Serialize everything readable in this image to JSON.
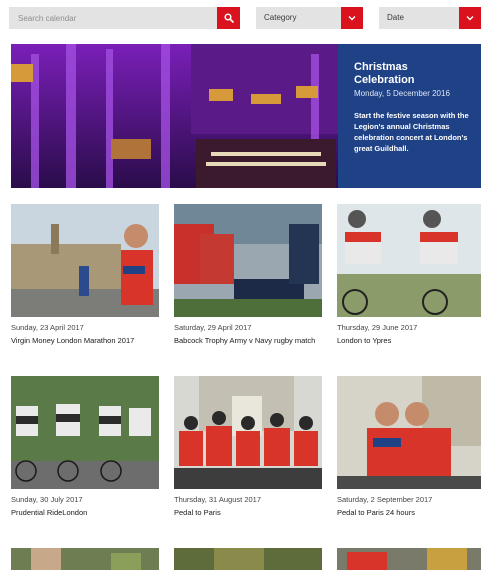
{
  "search": {
    "placeholder": "Search calendar"
  },
  "filters": {
    "category_label": "Category",
    "date_label": "Date"
  },
  "featured": {
    "title": "Christmas Celebration",
    "date": "Monday, 5 December 2016",
    "description": "Start the festive season with the Legion's annual Christmas celebration concert at London's great Guildhall."
  },
  "events": [
    {
      "date": "Sunday, 23 April 2017",
      "name": "Virgin Money London Marathon 2017"
    },
    {
      "date": "Saturday, 29 April 2017",
      "name": "Babcock Trophy Army v Navy rugby match"
    },
    {
      "date": "Thursday, 29 June 2017",
      "name": "London to Ypres"
    },
    {
      "date": "Sunday, 30 July 2017",
      "name": "Prudential RideLondon"
    },
    {
      "date": "Thursday, 31 August 2017",
      "name": "Pedal to Paris"
    },
    {
      "date": "Saturday, 2 September 2017",
      "name": "Pedal to Paris 24 hours"
    }
  ],
  "colors": {
    "accent_red": "#d9121d",
    "panel_blue": "#1f4287"
  }
}
